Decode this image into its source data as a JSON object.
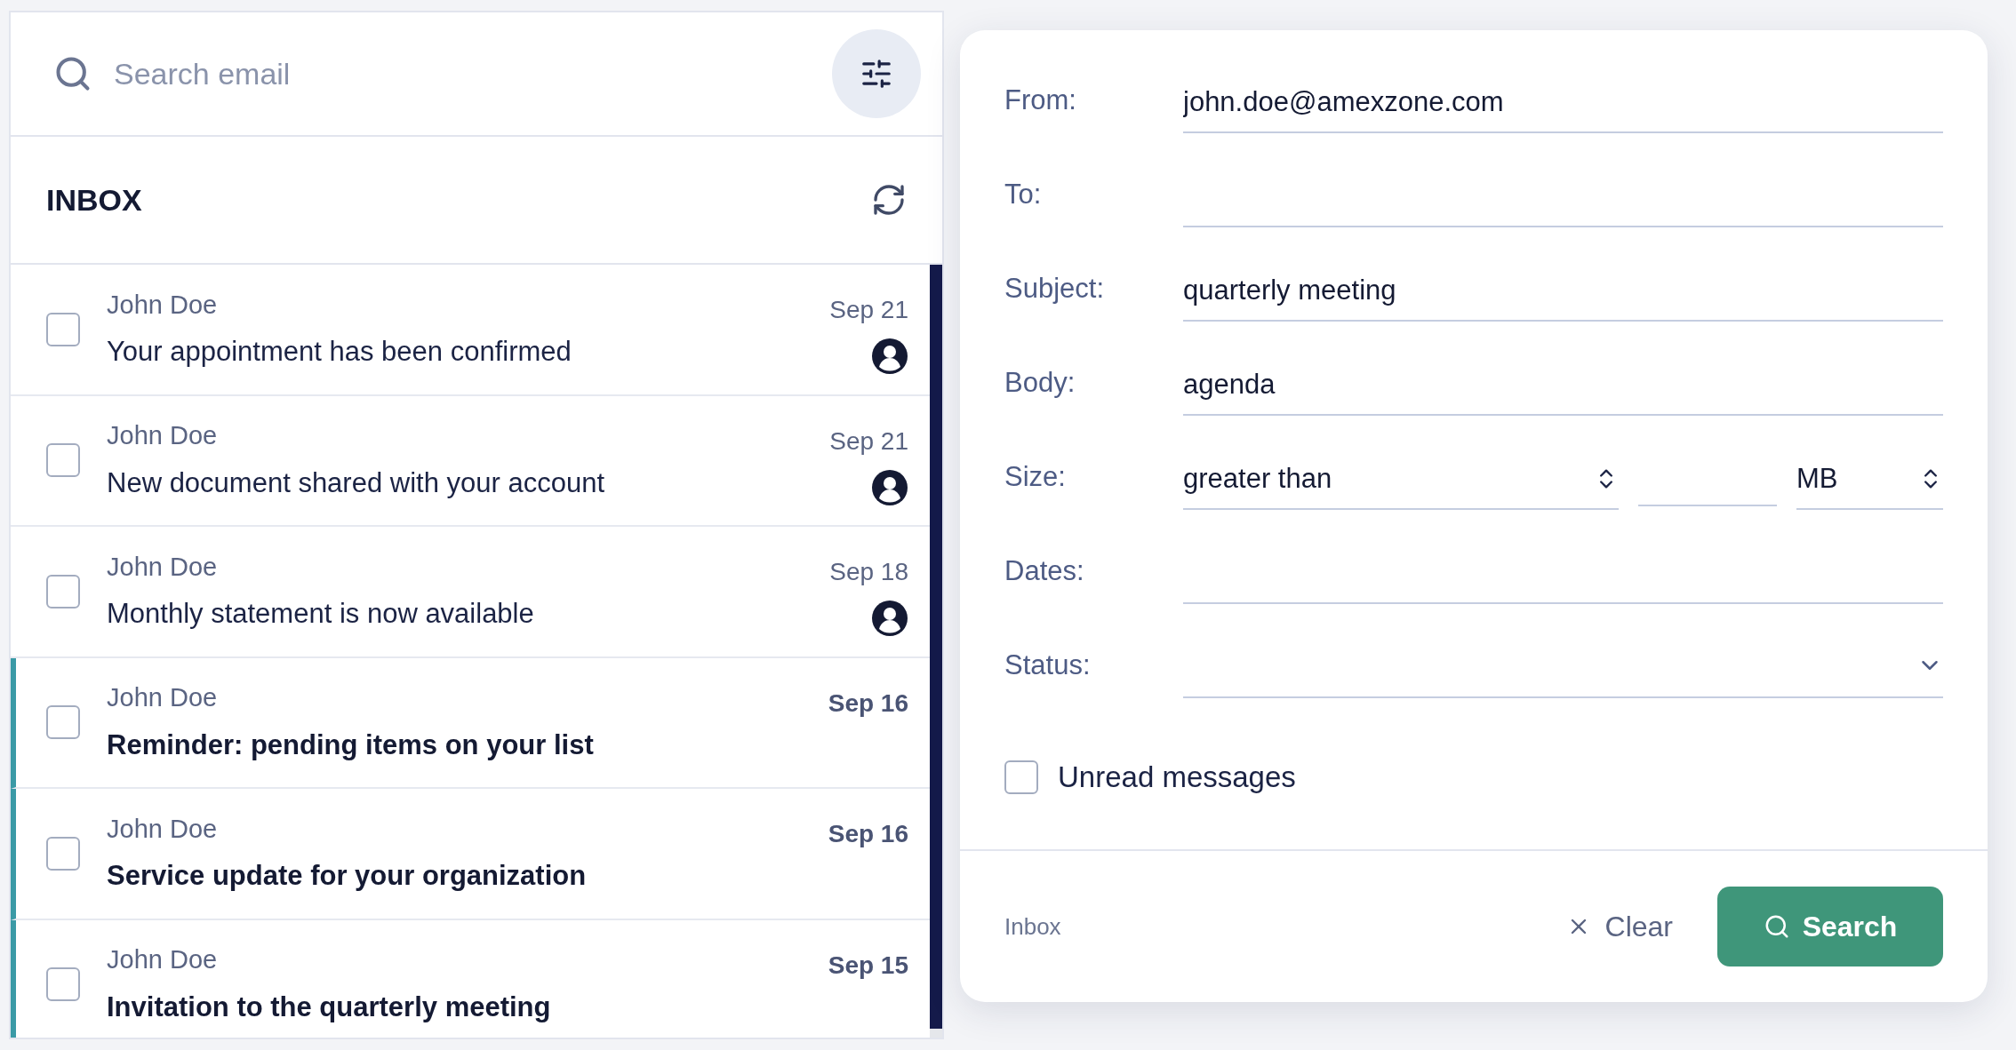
{
  "search": {
    "placeholder": "Search email"
  },
  "inbox": {
    "title": "INBOX"
  },
  "emails": [
    {
      "sender": "John Doe",
      "subject": "Your appointment has been confirmed",
      "date": "Sep 21",
      "unread": false,
      "checked": false
    },
    {
      "sender": "John Doe",
      "subject": "New document shared with your account",
      "date": "Sep 21",
      "unread": false,
      "checked": false
    },
    {
      "sender": "John Doe",
      "subject": "Monthly statement is now available",
      "date": "Sep 18",
      "unread": false,
      "checked": false
    },
    {
      "sender": "John Doe",
      "subject": "Reminder: pending items on your list",
      "date": "Sep 16",
      "unread": true,
      "checked": false
    },
    {
      "sender": "John Doe",
      "subject": "Service update for your organization",
      "date": "Sep 16",
      "unread": true,
      "checked": false
    },
    {
      "sender": "John Doe",
      "subject": "Invitation to the quarterly meeting",
      "date": "Sep 15",
      "unread": true,
      "checked": false
    }
  ],
  "filter": {
    "fields": [
      {
        "kind": "text",
        "label": "From:",
        "value": "john.doe@amexzone.com"
      },
      {
        "kind": "text",
        "label": "To:"
      },
      {
        "kind": "text",
        "label": "Subject:",
        "value": "quarterly meeting"
      },
      {
        "kind": "text",
        "label": "Body:",
        "value": "agenda"
      },
      {
        "kind": "size",
        "label": "Size:",
        "comparison": "greater than",
        "unit": "MB"
      },
      {
        "kind": "text",
        "label": "Dates:"
      },
      {
        "kind": "select",
        "label": "Status:"
      }
    ],
    "unread_only": {
      "label": "Unread messages",
      "checked": false
    },
    "folder": "Inbox",
    "clear_label": "Clear",
    "search_label": "Search"
  }
}
